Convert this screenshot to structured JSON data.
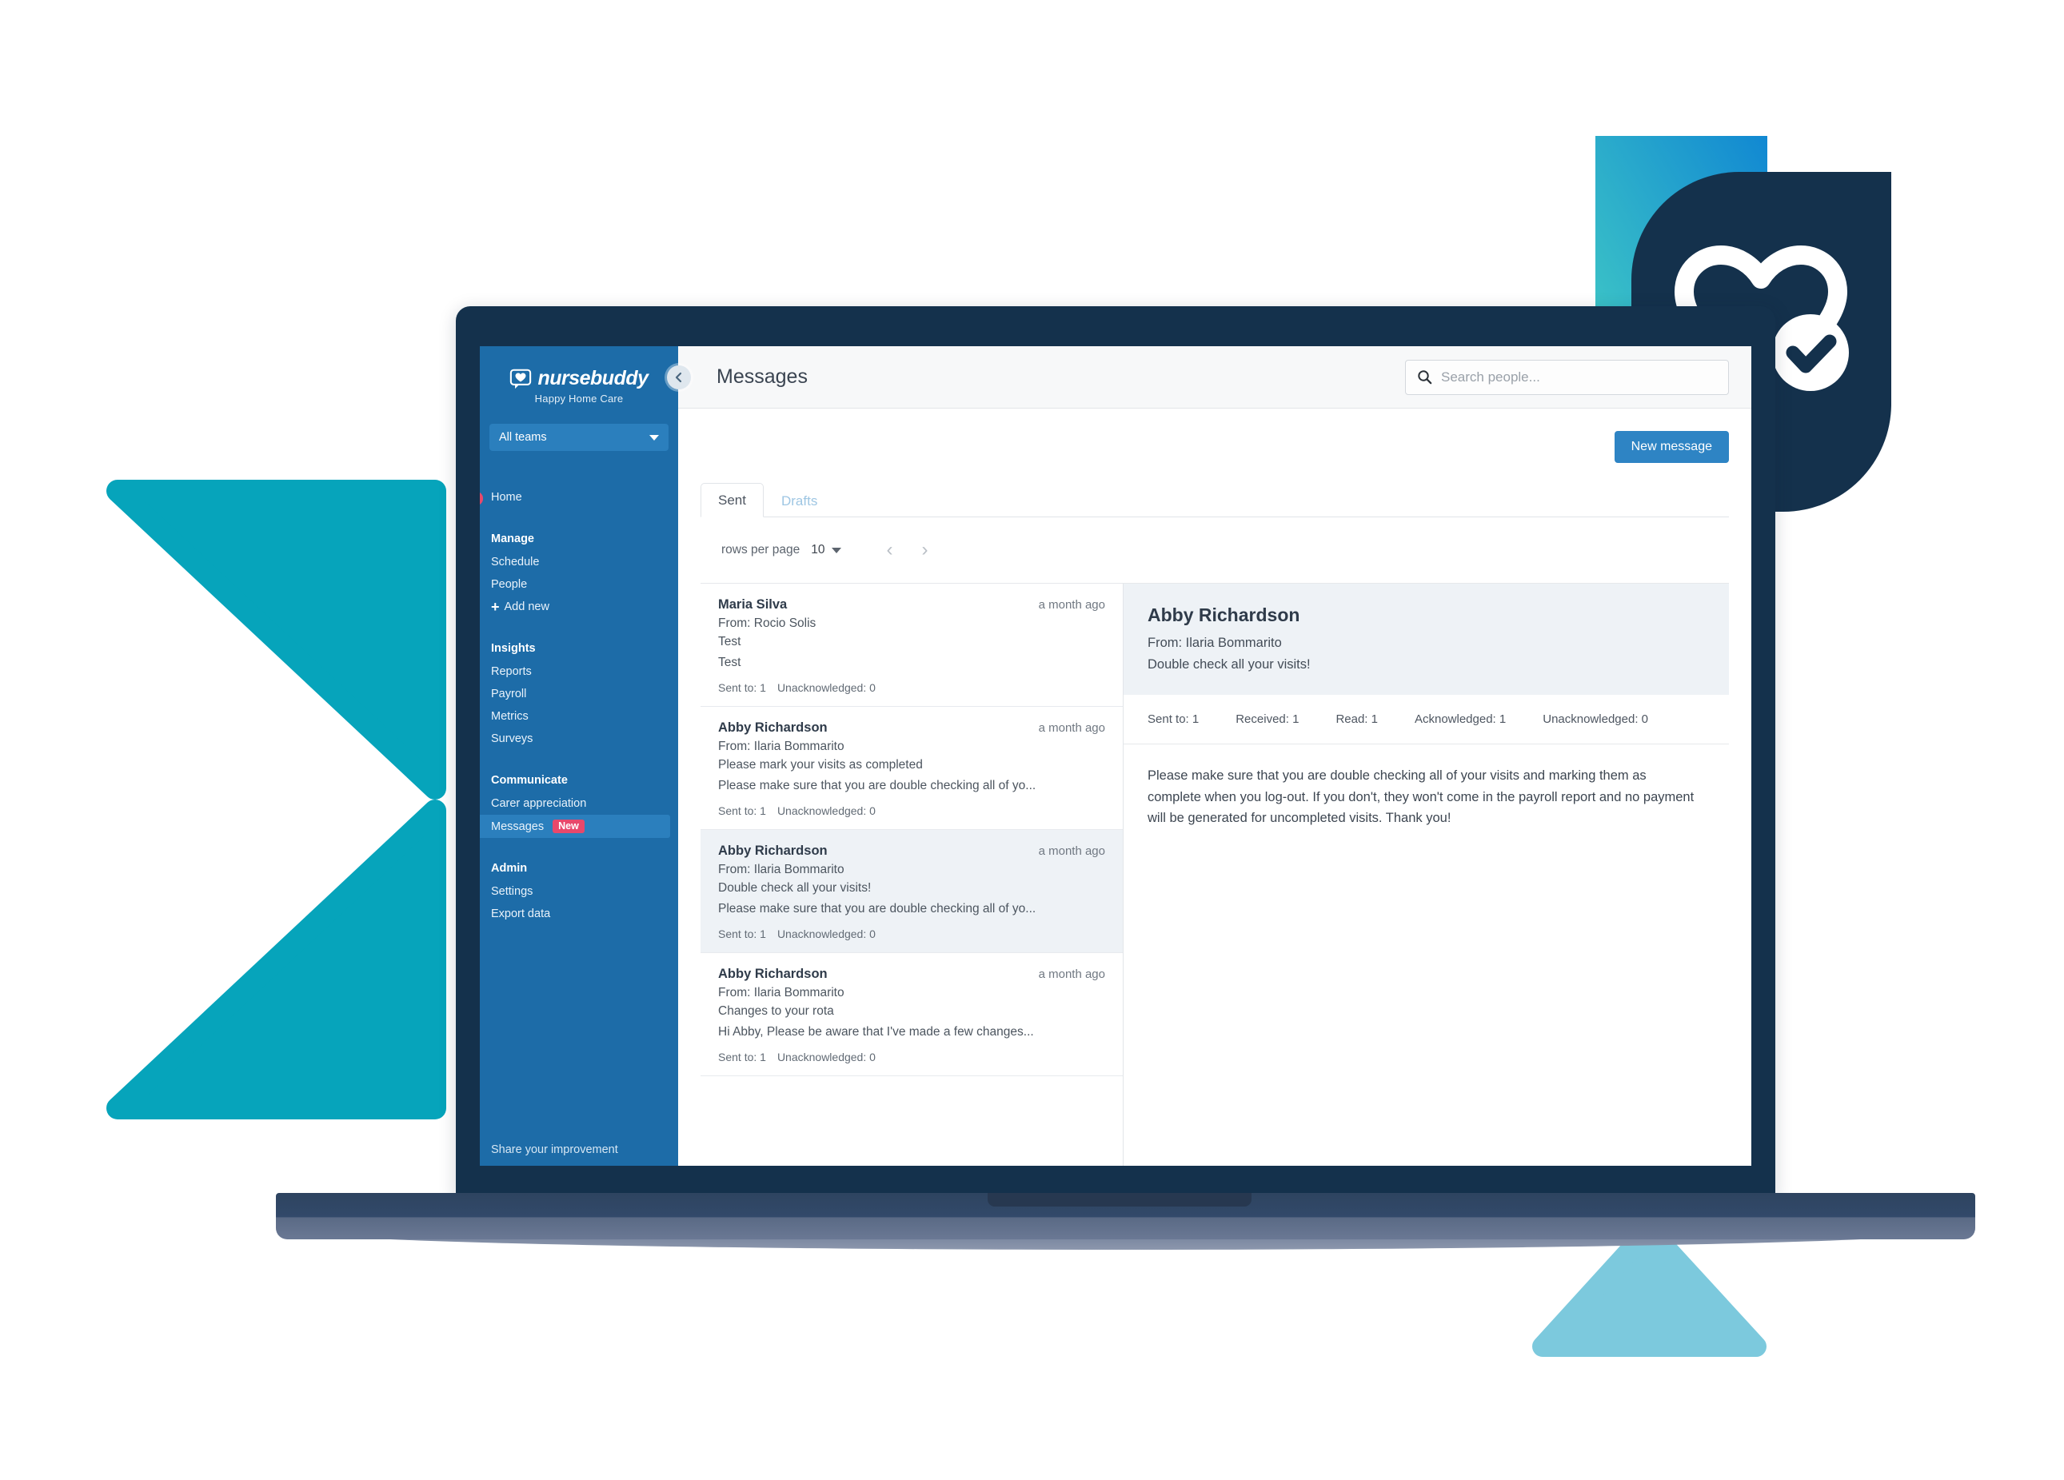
{
  "brand": {
    "name": "nursebuddy",
    "subtitle": "Happy Home Care",
    "logo_icon": "heart-speech-bubble-icon"
  },
  "sidebar": {
    "team_filter": {
      "value": "All teams",
      "icon": "chevron-down-icon"
    },
    "home": {
      "label": "Home"
    },
    "groups": [
      {
        "title": "Manage",
        "items": [
          {
            "label": "Schedule"
          },
          {
            "label": "People"
          },
          {
            "label": "Add new",
            "icon": "plus-icon"
          }
        ]
      },
      {
        "title": "Insights",
        "items": [
          {
            "label": "Reports"
          },
          {
            "label": "Payroll"
          },
          {
            "label": "Metrics"
          },
          {
            "label": "Surveys"
          }
        ]
      },
      {
        "title": "Communicate",
        "items": [
          {
            "label": "Carer appreciation"
          },
          {
            "label": "Messages",
            "badge": "New",
            "active": true
          }
        ]
      },
      {
        "title": "Admin",
        "items": [
          {
            "label": "Settings"
          },
          {
            "label": "Export data"
          }
        ]
      }
    ],
    "footer_link": "Share your improvement",
    "collapse_button_icon": "chevron-left-icon"
  },
  "header": {
    "title": "Messages",
    "search": {
      "placeholder": "Search people...",
      "value": "",
      "icon": "search-icon"
    }
  },
  "toolbar": {
    "new_message_label": "New message",
    "rows_per_page_label": "rows per page",
    "rows_per_page_value": "10",
    "prev_page_icon": "chevron-left-icon",
    "next_page_icon": "chevron-right-icon"
  },
  "tabs": [
    {
      "label": "Sent",
      "active": true
    },
    {
      "label": "Drafts",
      "active": false
    }
  ],
  "message_list": [
    {
      "name": "Maria Silva",
      "time": "a month ago",
      "from": "From: Rocio Solis",
      "subject": "Test",
      "preview": "Test",
      "sent_to": "Sent to: 1",
      "unacknowledged": "Unacknowledged: 0",
      "selected": false
    },
    {
      "name": "Abby Richardson",
      "time": "a month ago",
      "from": "From: Ilaria Bommarito",
      "subject": "Please mark your visits as completed",
      "preview": "Please make sure that you are double checking all of yo...",
      "sent_to": "Sent to: 1",
      "unacknowledged": "Unacknowledged: 0",
      "selected": false
    },
    {
      "name": "Abby Richardson",
      "time": "a month ago",
      "from": "From: Ilaria Bommarito",
      "subject": "Double check all your visits!",
      "preview": "Please make sure that you are double checking all of yo...",
      "sent_to": "Sent to: 1",
      "unacknowledged": "Unacknowledged: 0",
      "selected": true
    },
    {
      "name": "Abby Richardson",
      "time": "a month ago",
      "from": "From: Ilaria Bommarito",
      "subject": "Changes to your rota",
      "preview": "Hi Abby, Please be aware that I've made a few changes...",
      "sent_to": "Sent to: 1",
      "unacknowledged": "Unacknowledged: 0",
      "selected": false
    }
  ],
  "detail": {
    "name": "Abby Richardson",
    "from": "From: Ilaria Bommarito",
    "subject": "Double check all your visits!",
    "stats": [
      "Sent to: 1",
      "Received: 1",
      "Read: 1",
      "Acknowledged: 1",
      "Unacknowledged: 0"
    ],
    "body": "Please make sure that you are double checking all of your visits and marking them as complete when you log-out. If you don't, they won't come in the payroll report and no payment will be generated for uncompleted visits. Thank you!"
  },
  "decorations": {
    "badge_icon": "heart-check-shield-icon",
    "colors": {
      "sidebar_blue": "#1d6ca8",
      "accent_blue": "#2e84c4",
      "teal": "#06a4bb",
      "light_blue": "#7cc9dd",
      "navy": "#14314c",
      "badge_gradient_start": "#45d0c4",
      "badge_gradient_end": "#1188d2",
      "new_badge_pink": "#e8486b"
    }
  }
}
